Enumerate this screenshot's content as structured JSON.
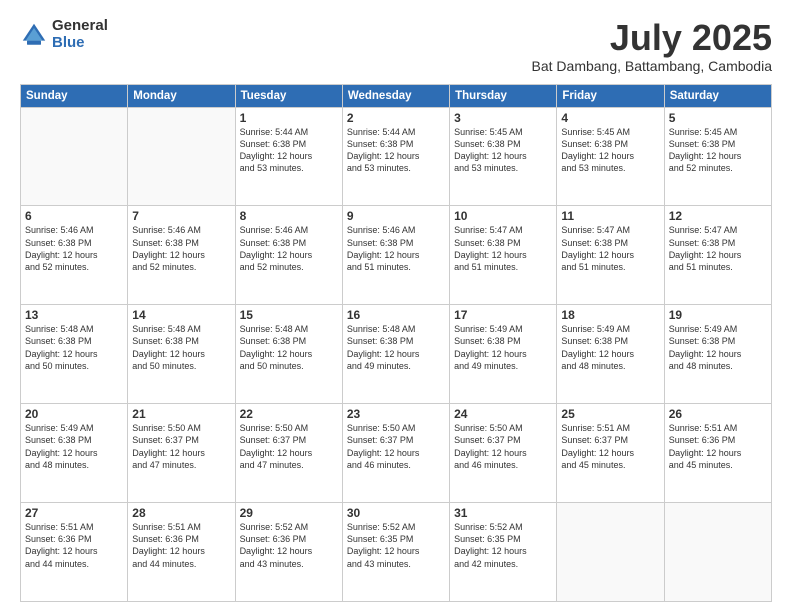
{
  "logo": {
    "general": "General",
    "blue": "Blue"
  },
  "title": "July 2025",
  "location": "Bat Dambang, Battambang, Cambodia",
  "weekdays": [
    "Sunday",
    "Monday",
    "Tuesday",
    "Wednesday",
    "Thursday",
    "Friday",
    "Saturday"
  ],
  "weeks": [
    [
      {
        "day": "",
        "info": ""
      },
      {
        "day": "",
        "info": ""
      },
      {
        "day": "1",
        "info": "Sunrise: 5:44 AM\nSunset: 6:38 PM\nDaylight: 12 hours\nand 53 minutes."
      },
      {
        "day": "2",
        "info": "Sunrise: 5:44 AM\nSunset: 6:38 PM\nDaylight: 12 hours\nand 53 minutes."
      },
      {
        "day": "3",
        "info": "Sunrise: 5:45 AM\nSunset: 6:38 PM\nDaylight: 12 hours\nand 53 minutes."
      },
      {
        "day": "4",
        "info": "Sunrise: 5:45 AM\nSunset: 6:38 PM\nDaylight: 12 hours\nand 53 minutes."
      },
      {
        "day": "5",
        "info": "Sunrise: 5:45 AM\nSunset: 6:38 PM\nDaylight: 12 hours\nand 52 minutes."
      }
    ],
    [
      {
        "day": "6",
        "info": "Sunrise: 5:46 AM\nSunset: 6:38 PM\nDaylight: 12 hours\nand 52 minutes."
      },
      {
        "day": "7",
        "info": "Sunrise: 5:46 AM\nSunset: 6:38 PM\nDaylight: 12 hours\nand 52 minutes."
      },
      {
        "day": "8",
        "info": "Sunrise: 5:46 AM\nSunset: 6:38 PM\nDaylight: 12 hours\nand 52 minutes."
      },
      {
        "day": "9",
        "info": "Sunrise: 5:46 AM\nSunset: 6:38 PM\nDaylight: 12 hours\nand 51 minutes."
      },
      {
        "day": "10",
        "info": "Sunrise: 5:47 AM\nSunset: 6:38 PM\nDaylight: 12 hours\nand 51 minutes."
      },
      {
        "day": "11",
        "info": "Sunrise: 5:47 AM\nSunset: 6:38 PM\nDaylight: 12 hours\nand 51 minutes."
      },
      {
        "day": "12",
        "info": "Sunrise: 5:47 AM\nSunset: 6:38 PM\nDaylight: 12 hours\nand 51 minutes."
      }
    ],
    [
      {
        "day": "13",
        "info": "Sunrise: 5:48 AM\nSunset: 6:38 PM\nDaylight: 12 hours\nand 50 minutes."
      },
      {
        "day": "14",
        "info": "Sunrise: 5:48 AM\nSunset: 6:38 PM\nDaylight: 12 hours\nand 50 minutes."
      },
      {
        "day": "15",
        "info": "Sunrise: 5:48 AM\nSunset: 6:38 PM\nDaylight: 12 hours\nand 50 minutes."
      },
      {
        "day": "16",
        "info": "Sunrise: 5:48 AM\nSunset: 6:38 PM\nDaylight: 12 hours\nand 49 minutes."
      },
      {
        "day": "17",
        "info": "Sunrise: 5:49 AM\nSunset: 6:38 PM\nDaylight: 12 hours\nand 49 minutes."
      },
      {
        "day": "18",
        "info": "Sunrise: 5:49 AM\nSunset: 6:38 PM\nDaylight: 12 hours\nand 48 minutes."
      },
      {
        "day": "19",
        "info": "Sunrise: 5:49 AM\nSunset: 6:38 PM\nDaylight: 12 hours\nand 48 minutes."
      }
    ],
    [
      {
        "day": "20",
        "info": "Sunrise: 5:49 AM\nSunset: 6:38 PM\nDaylight: 12 hours\nand 48 minutes."
      },
      {
        "day": "21",
        "info": "Sunrise: 5:50 AM\nSunset: 6:37 PM\nDaylight: 12 hours\nand 47 minutes."
      },
      {
        "day": "22",
        "info": "Sunrise: 5:50 AM\nSunset: 6:37 PM\nDaylight: 12 hours\nand 47 minutes."
      },
      {
        "day": "23",
        "info": "Sunrise: 5:50 AM\nSunset: 6:37 PM\nDaylight: 12 hours\nand 46 minutes."
      },
      {
        "day": "24",
        "info": "Sunrise: 5:50 AM\nSunset: 6:37 PM\nDaylight: 12 hours\nand 46 minutes."
      },
      {
        "day": "25",
        "info": "Sunrise: 5:51 AM\nSunset: 6:37 PM\nDaylight: 12 hours\nand 45 minutes."
      },
      {
        "day": "26",
        "info": "Sunrise: 5:51 AM\nSunset: 6:36 PM\nDaylight: 12 hours\nand 45 minutes."
      }
    ],
    [
      {
        "day": "27",
        "info": "Sunrise: 5:51 AM\nSunset: 6:36 PM\nDaylight: 12 hours\nand 44 minutes."
      },
      {
        "day": "28",
        "info": "Sunrise: 5:51 AM\nSunset: 6:36 PM\nDaylight: 12 hours\nand 44 minutes."
      },
      {
        "day": "29",
        "info": "Sunrise: 5:52 AM\nSunset: 6:36 PM\nDaylight: 12 hours\nand 43 minutes."
      },
      {
        "day": "30",
        "info": "Sunrise: 5:52 AM\nSunset: 6:35 PM\nDaylight: 12 hours\nand 43 minutes."
      },
      {
        "day": "31",
        "info": "Sunrise: 5:52 AM\nSunset: 6:35 PM\nDaylight: 12 hours\nand 42 minutes."
      },
      {
        "day": "",
        "info": ""
      },
      {
        "day": "",
        "info": ""
      }
    ]
  ]
}
